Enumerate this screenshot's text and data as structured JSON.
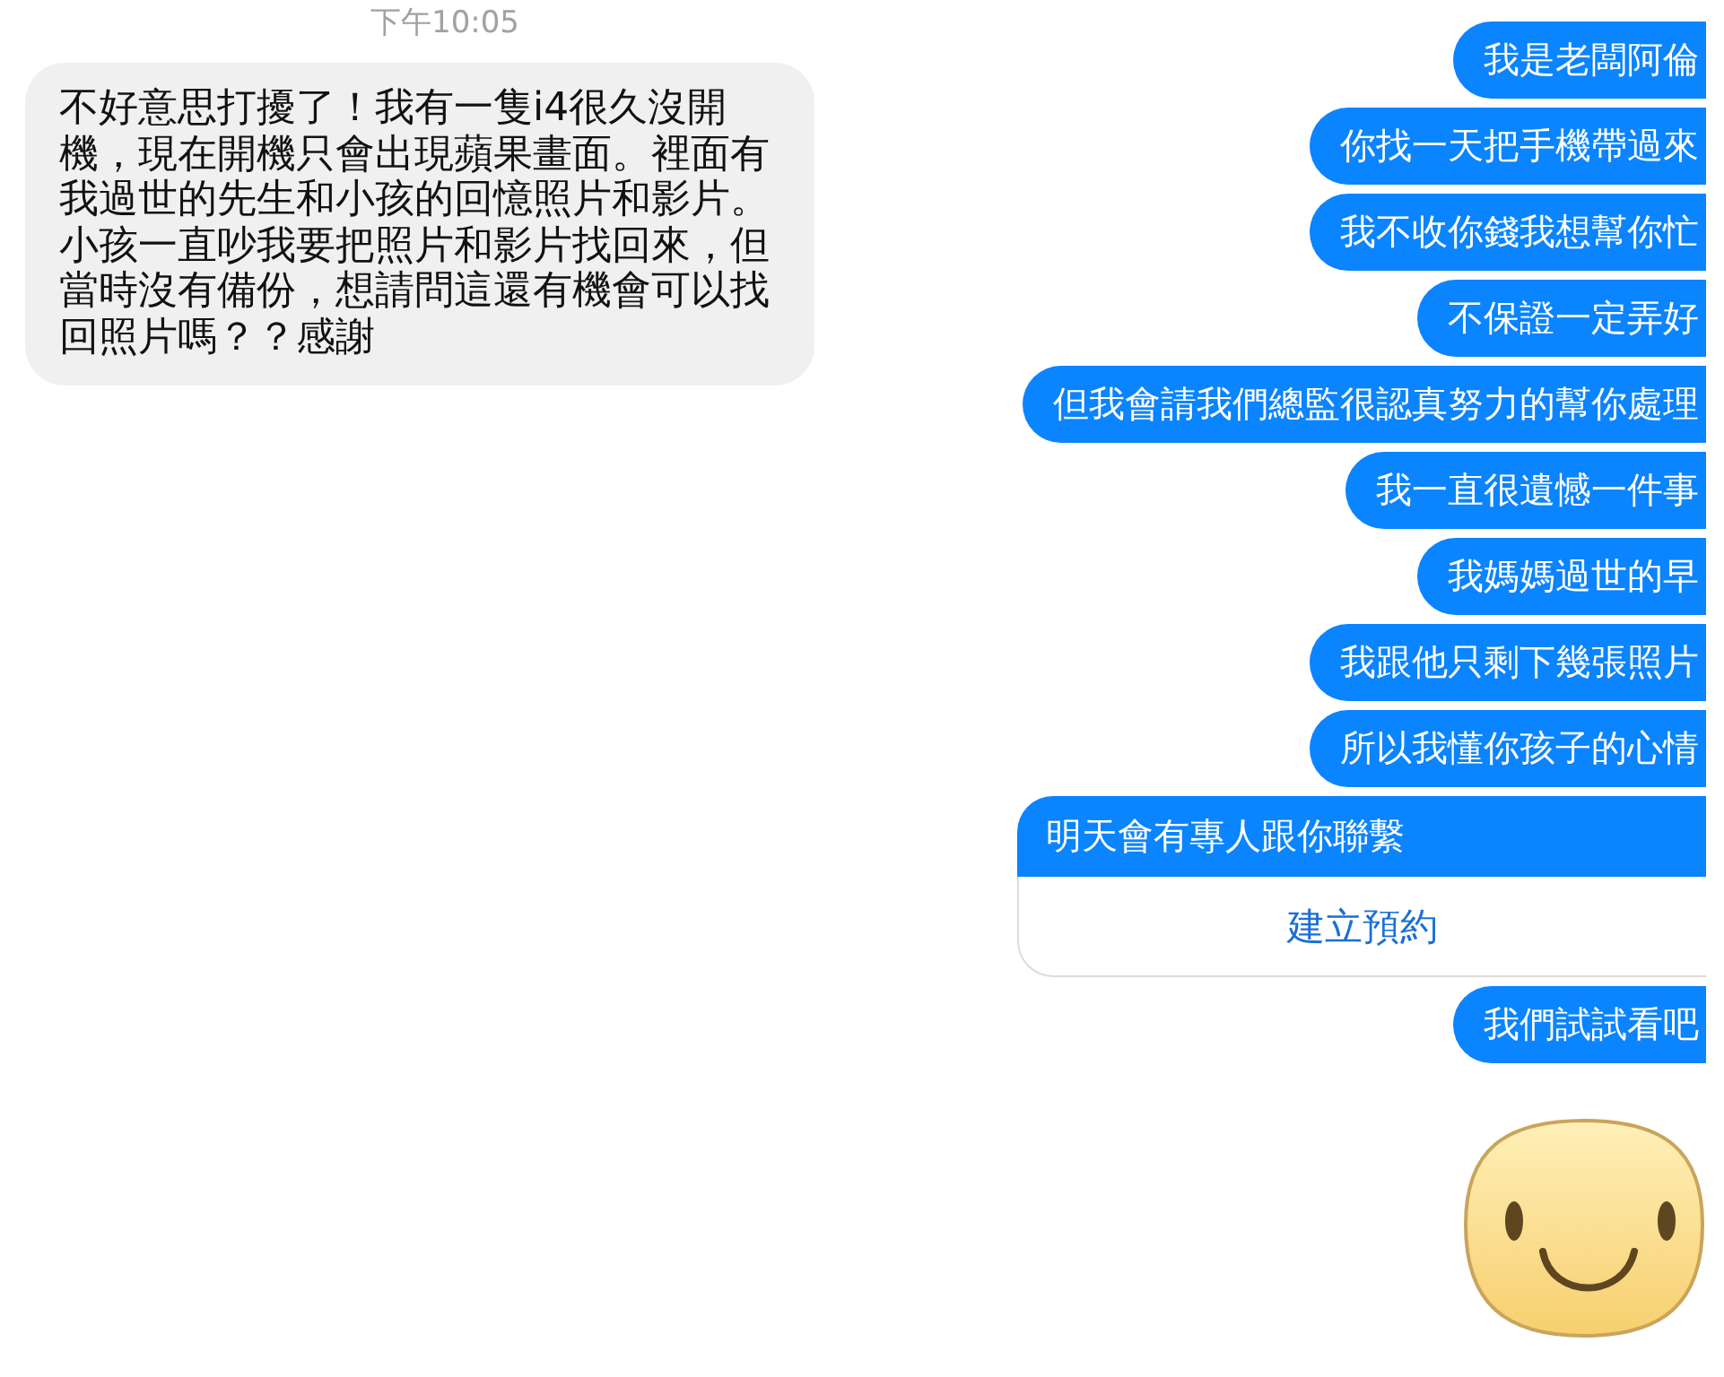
{
  "timestamp": "下午10:05",
  "received": [
    {
      "text": "不好意思打擾了！我有一隻i4很久沒開機，現在開機只會出現蘋果畫面。裡面有我過世的先生和小孩的回憶照片和影片。小孩一直吵我要把照片和影片找回來，但當時沒有備份，想請問這還有機會可以找回照片嗎？？感謝"
    }
  ],
  "sent": [
    {
      "kind": "text",
      "text": "我是老闆阿倫"
    },
    {
      "kind": "text",
      "text": "你找一天把手機帶過來"
    },
    {
      "kind": "text",
      "text": "我不收你錢我想幫你忙"
    },
    {
      "kind": "text",
      "text": "不保證一定弄好"
    },
    {
      "kind": "text",
      "text": "但我會請我們總監很認真努力的幫你處理"
    },
    {
      "kind": "text",
      "text": "我一直很遺憾一件事"
    },
    {
      "kind": "text",
      "text": "我媽媽過世的早"
    },
    {
      "kind": "text",
      "text": "我跟他只剩下幾張照片"
    },
    {
      "kind": "text",
      "text": "所以我懂你孩子的心情"
    },
    {
      "kind": "card",
      "text": "明天會有專人跟你聯繫",
      "button": "建立預約"
    },
    {
      "kind": "text",
      "text": "我們試試看吧"
    },
    {
      "kind": "sticker"
    }
  ]
}
